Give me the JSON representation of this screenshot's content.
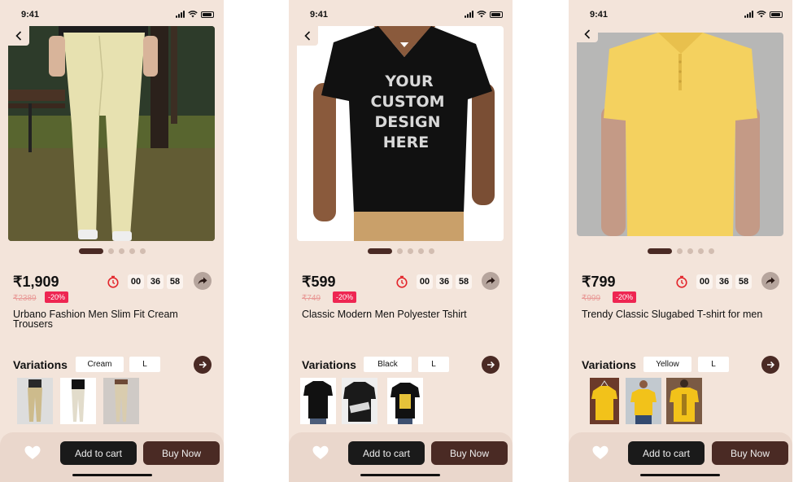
{
  "status_time": "9:41",
  "colors": {
    "accent": "#4a2a24",
    "discount": "#ee2652",
    "old_price": "#e99a97",
    "background": "#f3e4da"
  },
  "products": [
    {
      "price": "₹1,909",
      "old_price": "₹2389",
      "discount": "-20%",
      "title": "Urbano Fashion Men Slim Fit Cream Trousers",
      "timer": [
        "00",
        "36",
        "58"
      ],
      "variations_label": "Variations",
      "color_option": "Cream",
      "size_option": "L",
      "add_to_cart": "Add to cart",
      "buy_now": "Buy Now",
      "images": [
        "cream-trousers-park",
        "cream-trousers-front",
        "cream-trousers-back",
        "cream-trousers-side"
      ]
    },
    {
      "price": "₹599",
      "old_price": "₹749",
      "discount": "-20%",
      "title": "Classic Modern Men Polyester Tshirt",
      "timer": [
        "00",
        "36",
        "58"
      ],
      "variations_label": "Variations",
      "color_option": "Black",
      "size_option": "L",
      "add_to_cart": "Add to cart",
      "buy_now": "Buy Now",
      "hero_text": [
        "YOUR",
        "CUSTOM",
        "DESIGN",
        "HERE"
      ],
      "images": [
        "black-tshirt",
        "black-tshirt-print-zoom",
        "black-tshirt-graphic"
      ]
    },
    {
      "price": "₹799",
      "old_price": "₹999",
      "discount": "-20%",
      "title": "Trendy Classic Slugabed T-shirt for men",
      "timer": [
        "00",
        "36",
        "58"
      ],
      "variations_label": "Variations",
      "color_option": "Yellow",
      "size_option": "L",
      "add_to_cart": "Add to cart",
      "buy_now": "Buy Now",
      "images": [
        "yellow-tshirt-hanger",
        "yellow-tshirt-model",
        "yellow-tshirt-back-print"
      ]
    }
  ]
}
